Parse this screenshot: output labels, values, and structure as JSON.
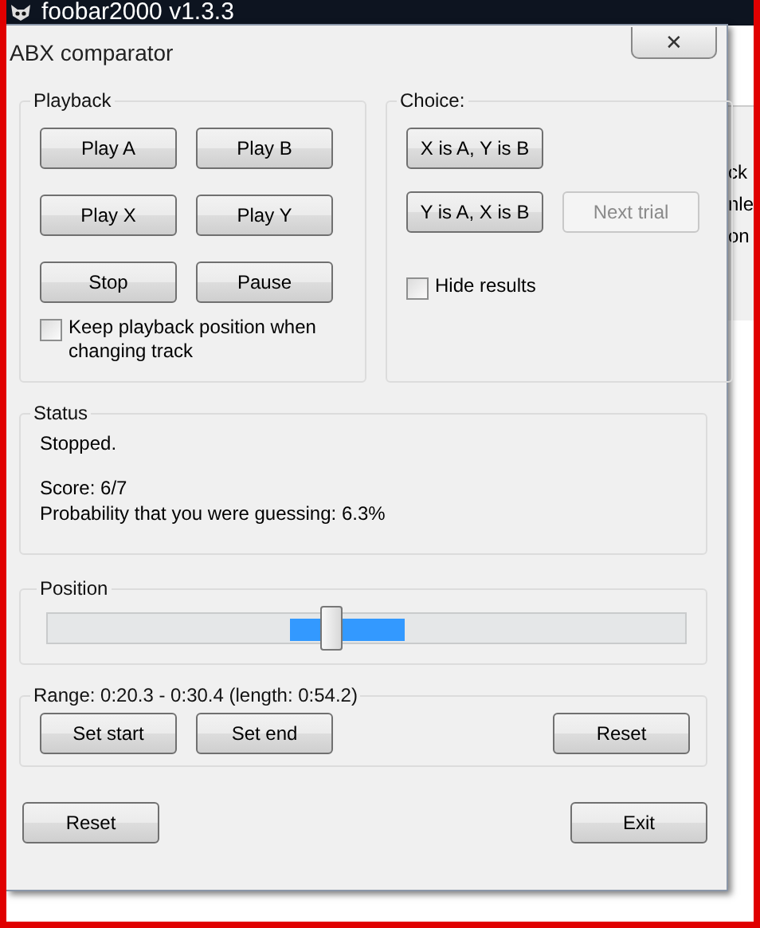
{
  "app_title": "foobar2000 v1.3.3",
  "background_window": {
    "fragments": [
      "ck",
      "nle",
      "on"
    ]
  },
  "dialog": {
    "title": "ABX comparator",
    "close": "✕"
  },
  "playback": {
    "title": "Playback",
    "buttons": [
      {
        "label": "Play A",
        "disabled": false
      },
      {
        "label": "Play B",
        "disabled": false
      },
      {
        "label": "Play X",
        "disabled": false
      },
      {
        "label": "Play Y",
        "disabled": false
      },
      {
        "label": "Stop",
        "disabled": false
      },
      {
        "label": "Pause",
        "disabled": false
      }
    ],
    "keep_position": {
      "label": "Keep playback position when changing track",
      "checked": false
    }
  },
  "choice": {
    "title": "Choice:",
    "buttons": [
      {
        "label": "X is A, Y is B",
        "disabled": false
      },
      {
        "label": "Y is A, X is B",
        "disabled": false
      },
      {
        "label": "Next trial",
        "disabled": true
      }
    ],
    "hide_results": {
      "label": "Hide results",
      "checked": false
    }
  },
  "status": {
    "title": "Status",
    "lines": [
      "Stopped.",
      "Score: 6/7",
      "Probability that you were guessing: 6.3%"
    ]
  },
  "position": {
    "title": "Position",
    "slider": {
      "level": 0.445
    }
  },
  "range": {
    "title": "Range: 0:20.3 - 0:30.4 (length: 0:54.2)",
    "buttons": [
      {
        "label": "Set start",
        "disabled": false
      },
      {
        "label": "Set end",
        "disabled": false
      },
      {
        "label": "Reset",
        "disabled": false
      }
    ]
  },
  "footer": {
    "buttons": [
      {
        "label": "Reset",
        "disabled": false
      },
      {
        "label": "Exit",
        "disabled": false
      }
    ]
  }
}
